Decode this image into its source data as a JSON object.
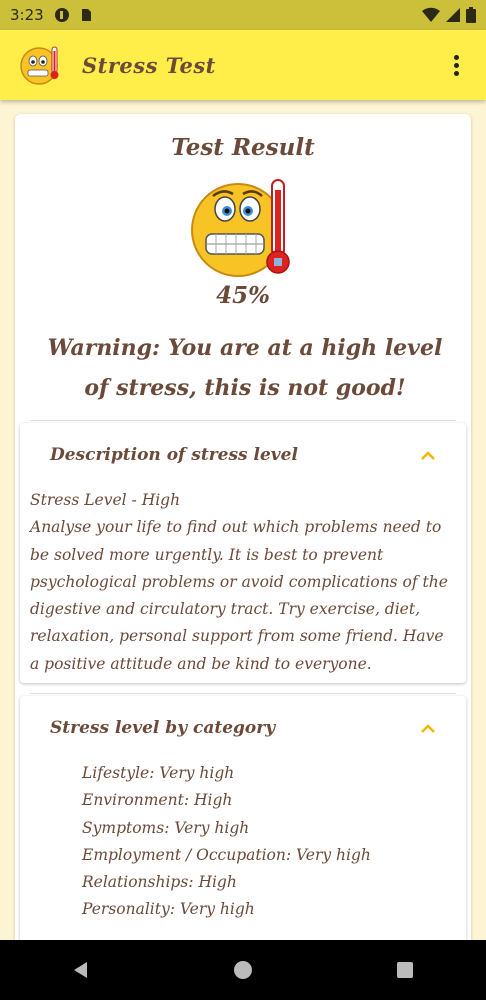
{
  "status_bar": {
    "time": "3:23"
  },
  "app_bar": {
    "title": "Stress Test",
    "icons": [
      "stress-emoji-icon",
      "more-vert-icon"
    ]
  },
  "result": {
    "heading": "Test Result",
    "percent": "45%",
    "warning": "Warning: You are at a high level of stress, this is not good!"
  },
  "description_panel": {
    "title": "Description of stress level",
    "level_line": "Stress Level - High",
    "body": "Analyse your life to find out which problems need to be solved more urgently. It is best to prevent psychological problems or avoid complications of the digestive and circulatory tract. Try exercise, diet, relaxation, personal support from some friend. Have a positive attitude and be kind to everyone."
  },
  "category_panel": {
    "title": "Stress level by category",
    "items": [
      "Lifestyle: Very high",
      "Environment: High",
      "Symptoms: Very high",
      "Employment / Occupation: Very high",
      "Relationships: High",
      "Personality: Very high"
    ]
  },
  "colors": {
    "accent": "#ffee4a",
    "status_bar": "#ccbf3a",
    "text": "#6b4a3a",
    "chevron": "#f2b800"
  }
}
